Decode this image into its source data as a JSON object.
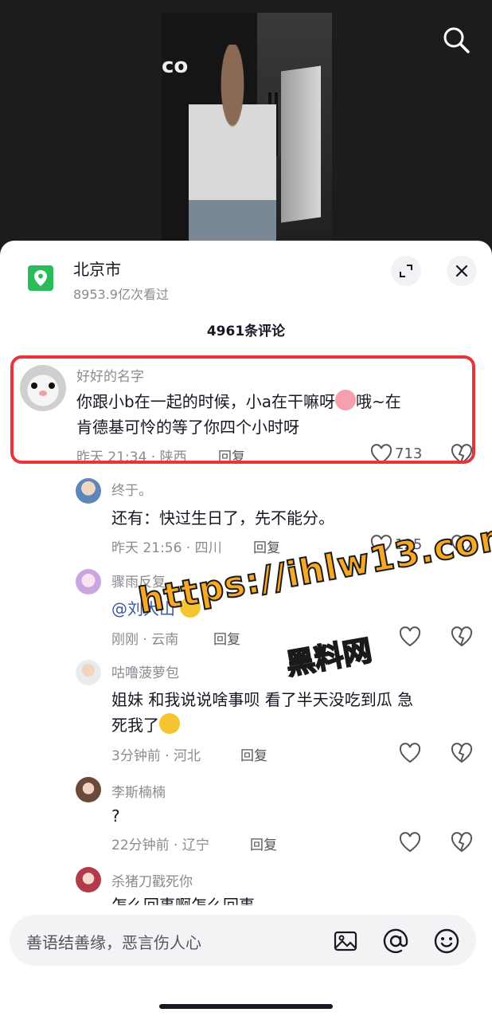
{
  "header": {
    "location_title": "北京市",
    "location_views": "8953.9亿次看过",
    "icons": [
      "search-icon",
      "location-pin-icon",
      "expand-icon",
      "close-icon"
    ]
  },
  "comments_count": "4961条评论",
  "main_comment": {
    "name": "好好的名字",
    "text_line1": "你跟小b在一起的时候，小a在干嘛呀",
    "text_line1_tail": "哦~在",
    "text_line2": "肯德基可怜的等了你四个小时呀",
    "meta": "昨天 21:34 · 陕西",
    "reply": "回复",
    "likes": "713"
  },
  "replies": [
    {
      "name": "终于。",
      "text": "还有：快过生日了，先不能分。",
      "meta": "昨天 21:56 · 四川",
      "reply": "回复",
      "likes": "125"
    },
    {
      "name": "骤雨反复",
      "mention": "@刘大山",
      "meta": "刚刚 · 云南",
      "reply": "回复"
    },
    {
      "name": "咕噜菠萝包",
      "text_line1": "姐妹 和我说说啥事呗 看了半天没吃到瓜 急",
      "text_line2": "死我了",
      "meta": "3分钟前 · 河北",
      "reply": "回复"
    },
    {
      "name": "李斯楠楠",
      "text": "?",
      "meta": "22分钟前 · 辽宁",
      "reply": "回复"
    },
    {
      "name": "杀猪刀戳死你",
      "text": "怎么回事啊怎么回事"
    }
  ],
  "watermark": {
    "line1": "https://ihlw13.com",
    "line2": "黑料网"
  },
  "input": {
    "placeholder": "善语结善缘，恶言伤人心"
  },
  "colors": {
    "highlight": "#e8333a",
    "location_green": "#2bbb5a",
    "watermark": "#f7a826"
  }
}
